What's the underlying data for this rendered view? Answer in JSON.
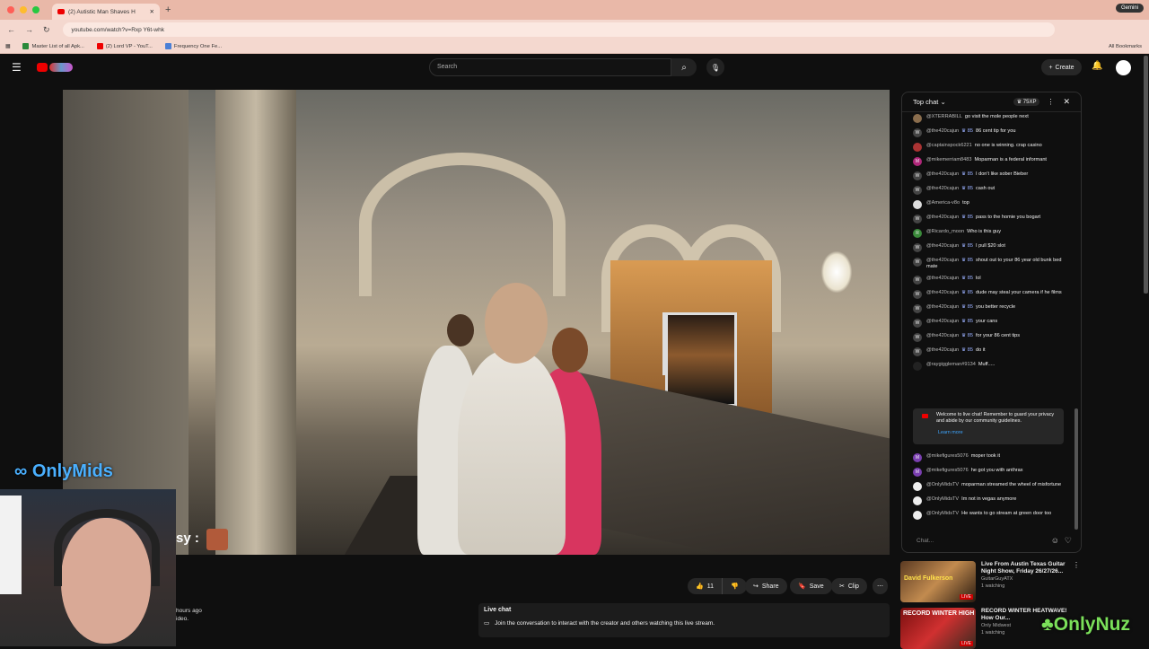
{
  "browser": {
    "tab_title": "(2) Autistic Man Shaves H",
    "url": "youtube.com/watch?v=Rxp Y6t-whk",
    "gemini_label": "Gemini",
    "bookmarks": [
      "Master List of all Apk...",
      "(2) Lord VP - YouT...",
      "Frequency One Fe..."
    ],
    "all_bookmarks_label": "All Bookmarks"
  },
  "youtube": {
    "search_placeholder": "Search",
    "create_label": "Create"
  },
  "video": {
    "overlay_brand": "OnlyMids",
    "overlay_text": "sy :",
    "like_count": "11",
    "share_label": "Share",
    "save_label": "Save",
    "clip_label": "Clip",
    "desc_time": "hours ago",
    "desc_line2": "ideo."
  },
  "live_chat_panel": {
    "title": "Live chat",
    "subtitle": "Join the conversation to interact with the creator and others watching this live stream."
  },
  "chat": {
    "header": "Top chat",
    "xp": "75XP",
    "messages": [
      {
        "name": "@XTERRABILL",
        "badge": "",
        "text": "go visit the mole people next",
        "avatar": "",
        "color": "#8a6d4d"
      },
      {
        "name": "@the420cajun",
        "badge": "♛ 85",
        "text": "86 cent tip for you",
        "avatar": "W",
        "color": "#444"
      },
      {
        "name": "@captainspock6221",
        "badge": "",
        "text": "no one is winning. crap casino",
        "avatar": "",
        "color": "#a33"
      },
      {
        "name": "@mikemerriam8483",
        "badge": "",
        "text": "Moparman is a federal informant",
        "avatar": "M",
        "color": "#b0277a"
      },
      {
        "name": "@the420cajun",
        "badge": "♛ 85",
        "text": "I don't like sober Bieber",
        "avatar": "W",
        "color": "#444"
      },
      {
        "name": "@the420cajun",
        "badge": "♛ 85",
        "text": "cash out",
        "avatar": "W",
        "color": "#444"
      },
      {
        "name": "@America-v8o",
        "badge": "",
        "text": "top",
        "avatar": "",
        "color": "#ddd"
      },
      {
        "name": "@the420cajun",
        "badge": "♛ 85",
        "text": "pass to the homie you bogart",
        "avatar": "W",
        "color": "#444"
      },
      {
        "name": "@Ricardo_moon",
        "badge": "",
        "text": "Who is this guy",
        "avatar": "R",
        "color": "#3a8a3a"
      },
      {
        "name": "@the420cajun",
        "badge": "♛ 85",
        "text": "I pull $20 slot",
        "avatar": "W",
        "color": "#444"
      },
      {
        "name": "@the420cajun",
        "badge": "♛ 85",
        "text": "shout out to your 86 year old bunk bed mate",
        "avatar": "W",
        "color": "#444"
      },
      {
        "name": "@the420cajun",
        "badge": "♛ 85",
        "text": "lol",
        "avatar": "W",
        "color": "#444"
      },
      {
        "name": "@the420cajun",
        "badge": "♛ 85",
        "text": "dude may steal your camera if he films",
        "avatar": "W",
        "color": "#444"
      },
      {
        "name": "@the420cajun",
        "badge": "♛ 85",
        "text": "you better recycle",
        "avatar": "W",
        "color": "#444"
      },
      {
        "name": "@the420cajun",
        "badge": "♛ 85",
        "text": "your cans",
        "avatar": "W",
        "color": "#444"
      },
      {
        "name": "@the420cajun",
        "badge": "♛ 85",
        "text": "for your 86 cent tips",
        "avatar": "W",
        "color": "#444"
      },
      {
        "name": "@the420cajun",
        "badge": "♛ 85",
        "text": "do it",
        "avatar": "W",
        "color": "#444"
      },
      {
        "name": "@raygiggleman#9134",
        "badge": "",
        "text": "Muff.....",
        "avatar": "",
        "color": "#222"
      }
    ],
    "welcome": "Welcome to live chat! Remember to guard your privacy and abide by our community guidelines.",
    "learn_more": "Learn more",
    "messages_after": [
      {
        "name": "@mikefigures5076",
        "text": "moper took it",
        "avatar": "M",
        "color": "#7a3fb0"
      },
      {
        "name": "@mikefigures5076",
        "text": "he got you with anthrax",
        "avatar": "M",
        "color": "#7a3fb0"
      },
      {
        "name": "@OnlyMidsTV",
        "text": "moparman streamed the wheel of misfortune",
        "avatar": "",
        "color": "#eee"
      },
      {
        "name": "@OnlyMidsTV",
        "text": "Im not in vegas anymore",
        "avatar": "",
        "color": "#eee"
      },
      {
        "name": "@OnlyMidsTV",
        "text": "He wants to go stream at green door too",
        "avatar": "",
        "color": "#eee"
      }
    ],
    "input_placeholder": "Chat..."
  },
  "recommendations": [
    {
      "title": "Live From Austin Texas Guitar Night Show, Friday 26/27/26...",
      "channel": "GuitarGuyATX",
      "meta": "1 watching",
      "thumb_text": "David Fulkerson",
      "badge": "LIVE"
    },
    {
      "title": "RECORD WINTER HEATWAVE! How Our...",
      "channel": "Only Midwest",
      "meta": "1 watching",
      "thumb_text": "RECORD WINTER HIGH",
      "badge": "LIVE"
    }
  ],
  "overlay_nuz": "OnlyNuz"
}
